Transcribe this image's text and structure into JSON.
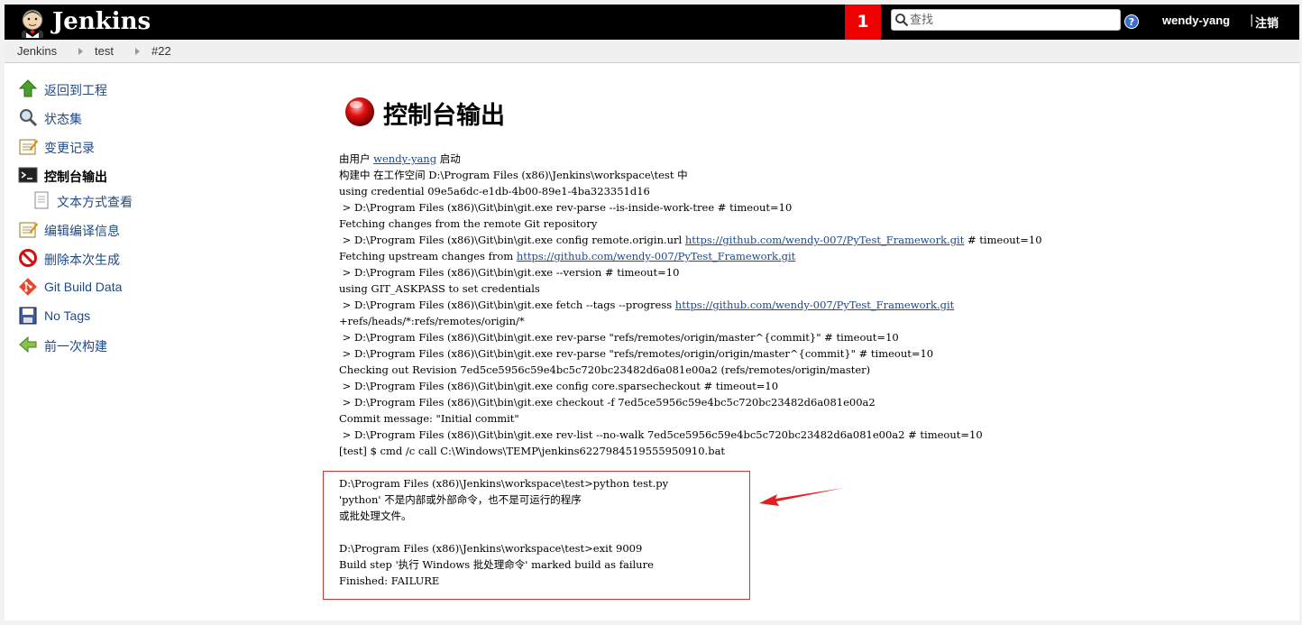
{
  "header": {
    "app_name": "Jenkins",
    "notification_count": "1",
    "search_placeholder": "查找",
    "username": "wendy-yang",
    "logout_sep": "|",
    "logout_label": "注销"
  },
  "breadcrumb": [
    "Jenkins",
    "test",
    "#22"
  ],
  "sidebar": {
    "items": [
      {
        "label": "返回到工程",
        "icon": "up-arrow-icon"
      },
      {
        "label": "状态集",
        "icon": "magnifier-icon"
      },
      {
        "label": "变更记录",
        "icon": "notepad-icon"
      },
      {
        "label": "控制台输出",
        "icon": "terminal-icon",
        "active": true
      },
      {
        "label": "文本方式查看",
        "icon": "document-icon",
        "sub": true
      },
      {
        "label": "编辑编译信息",
        "icon": "notepad-icon"
      },
      {
        "label": "删除本次生成",
        "icon": "no-entry-icon"
      },
      {
        "label": "Git Build Data",
        "icon": "git-icon"
      },
      {
        "label": "No Tags",
        "icon": "floppy-disk-icon"
      },
      {
        "label": "前一次构建",
        "icon": "left-arrow-icon"
      }
    ]
  },
  "main": {
    "title": "控制台输出",
    "status_color": "#e01010",
    "started_by_prefix": "由用户 ",
    "started_by_user": "wendy-yang",
    "started_by_suffix": " 启动",
    "console_lines": [
      [
        "构建中 在工作空间 D:\\Program Files (x86)\\Jenkins\\workspace\\test 中"
      ],
      [
        "using credential 09e5a6dc-e1db-4b00-89e1-4ba323351d16"
      ],
      [
        " > D:\\Program Files (x86)\\Git\\bin\\git.exe rev-parse --is-inside-work-tree # timeout=10"
      ],
      [
        "Fetching changes from the remote Git repository"
      ],
      [
        " > D:\\Program Files (x86)\\Git\\bin\\git.exe config remote.origin.url ",
        {
          "link": "https://github.com/wendy-007/PyTest_Framework.git"
        },
        " # timeout=10"
      ],
      [
        "Fetching upstream changes from ",
        {
          "link": "https://github.com/wendy-007/PyTest_Framework.git"
        }
      ],
      [
        " > D:\\Program Files (x86)\\Git\\bin\\git.exe --version # timeout=10"
      ],
      [
        "using GIT_ASKPASS to set credentials"
      ],
      [
        " > D:\\Program Files (x86)\\Git\\bin\\git.exe fetch --tags --progress ",
        {
          "link": "https://github.com/wendy-007/PyTest_Framework.git"
        }
      ],
      [
        "+refs/heads/*:refs/remotes/origin/*"
      ],
      [
        " > D:\\Program Files (x86)\\Git\\bin\\git.exe rev-parse \"refs/remotes/origin/master^{commit}\" # timeout=10"
      ],
      [
        " > D:\\Program Files (x86)\\Git\\bin\\git.exe rev-parse \"refs/remotes/origin/origin/master^{commit}\" # timeout=10"
      ],
      [
        "Checking out Revision 7ed5ce5956c59e4bc5c720bc23482d6a081e00a2 (refs/remotes/origin/master)"
      ],
      [
        " > D:\\Program Files (x86)\\Git\\bin\\git.exe config core.sparsecheckout # timeout=10"
      ],
      [
        " > D:\\Program Files (x86)\\Git\\bin\\git.exe checkout -f 7ed5ce5956c59e4bc5c720bc23482d6a081e00a2"
      ],
      [
        "Commit message: \"Initial commit\""
      ],
      [
        " > D:\\Program Files (x86)\\Git\\bin\\git.exe rev-list --no-walk 7ed5ce5956c59e4bc5c720bc23482d6a081e00a2 # timeout=10"
      ],
      [
        "[test] $ cmd /c call C:\\Windows\\TEMP\\jenkins6227984519555950910.bat"
      ],
      [
        ""
      ],
      [
        "D:\\Program Files (x86)\\Jenkins\\workspace\\test>python test.py"
      ],
      [
        "'python' 不是内部或外部命令，也不是可运行的程序"
      ],
      [
        "或批处理文件。"
      ],
      [
        ""
      ],
      [
        "D:\\Program Files (x86)\\Jenkins\\workspace\\test>exit 9009"
      ],
      [
        "Build step '执行 Windows 批处理命令' marked build as failure"
      ],
      [
        "Finished: FAILURE"
      ]
    ]
  }
}
